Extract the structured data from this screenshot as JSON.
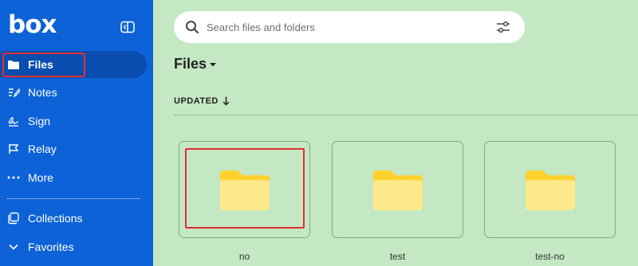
{
  "app": {
    "logo": "box"
  },
  "sidebar": {
    "items": [
      {
        "label": "Files",
        "icon": "folder-icon",
        "active": true
      },
      {
        "label": "Notes",
        "icon": "notes-icon"
      },
      {
        "label": "Sign",
        "icon": "sign-icon"
      },
      {
        "label": "Relay",
        "icon": "relay-icon"
      },
      {
        "label": "More",
        "icon": "more-icon"
      },
      {
        "label": "Collections",
        "icon": "collections-icon"
      },
      {
        "label": "Favorites",
        "icon": "chevron-down-icon"
      }
    ]
  },
  "search": {
    "placeholder": "Search files and folders"
  },
  "main": {
    "title": "Files",
    "sort_label": "UPDATED",
    "folders": [
      {
        "name": "no"
      },
      {
        "name": "test"
      },
      {
        "name": "test-no"
      }
    ]
  },
  "colors": {
    "sidebar": "#0c62d6",
    "background": "#c3e8c3",
    "folder": "#ffd93d",
    "highlight": "#e03030"
  }
}
